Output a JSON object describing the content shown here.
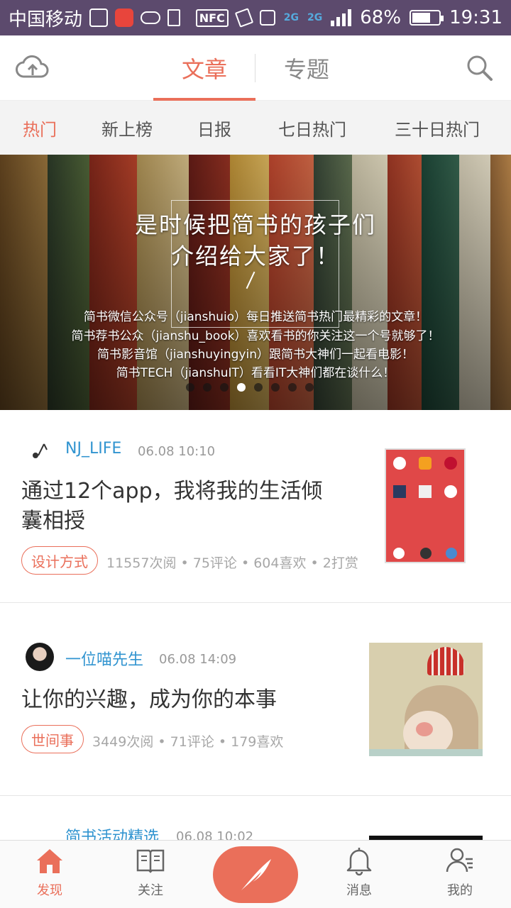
{
  "status_bar": {
    "carrier": "中国移动",
    "nfc": "NFC",
    "network_1": "2G",
    "network_2": "2G",
    "battery": "68%",
    "battery_level": 0.68,
    "time": "19:31"
  },
  "header": {
    "tabs": [
      "文章",
      "专题"
    ],
    "active_tab": "文章",
    "upload_icon": "cloud-upload-icon",
    "search_icon": "search-icon"
  },
  "subnav": {
    "items": [
      "热门",
      "新上榜",
      "日报",
      "七日热门",
      "三十日热门"
    ],
    "active": "热门"
  },
  "banner": {
    "title_line1": "是时候把简书的孩子们",
    "title_line2": "介绍给大家了！",
    "lines": [
      "简书微信公众号（jianshuio）每日推送简书热门最精彩的文章！",
      "简书荐书公众（jianshu_book）喜欢看书的你关注这一个号就够了！",
      "简书影音馆（jianshuyingyin）跟简书大神们一起看电影！",
      "简书TECH（jianshuIT）看看IT大神们都在谈什么！"
    ],
    "slide_count": 8,
    "active_slide": 4
  },
  "feed": [
    {
      "author": "NJ_LIFE",
      "time": "06.08 10:10",
      "title_line1": "通过12个app，我将我的生活倾",
      "title_line2": "囊相授",
      "tag": "设计方式",
      "stats": "11557次阅 • 75评论 • 604喜欢 • 2打赏"
    },
    {
      "author": "一位喵先生",
      "time": "06.08 14:09",
      "title_line1": "让你的兴趣，成为你的本事",
      "tag": "世间事",
      "stats": "3449次阅 • 71评论 • 179喜欢"
    },
    {
      "author": "简书活动精选",
      "time": "06.08 10:02"
    }
  ],
  "bottom_nav": {
    "discover": "发现",
    "follow": "关注",
    "messages": "消息",
    "mine": "我的",
    "accent": "#ea6f5a"
  }
}
